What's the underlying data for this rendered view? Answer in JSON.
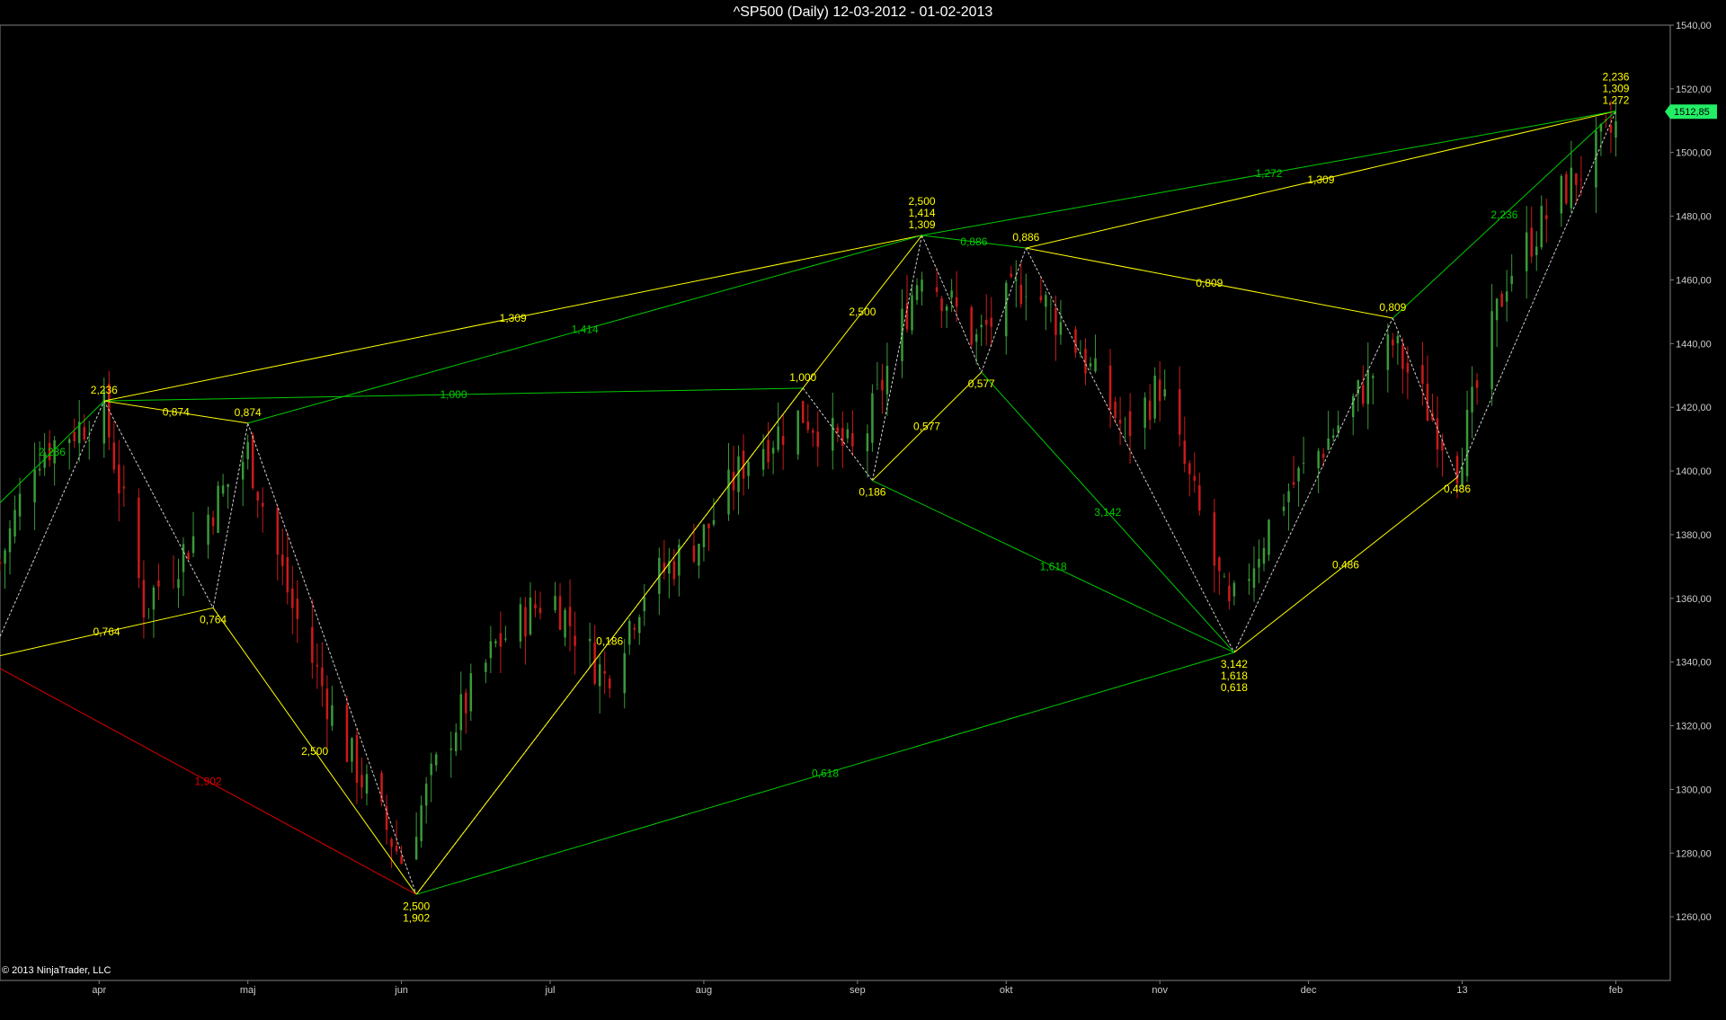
{
  "title": "^SP500 (Daily)  12-03-2012 - 01-02-2013",
  "copyright": "© 2013 NinjaTrader, LLC",
  "colors": {
    "background": "#000000",
    "axis": "#808080",
    "up_bar": "#3a9a3a",
    "down_bar": "#cc1a1a",
    "fib_yellow": "#ffff00",
    "fib_green": "#00cc00",
    "fib_red": "#dd0000",
    "zigzag": "#cfcfcf",
    "last_price_bg": "#22ee66"
  },
  "chart_data": {
    "type": "candlestick",
    "ylim": [
      1240,
      1540
    ],
    "y_ticks": [
      1260,
      1280,
      1300,
      1320,
      1340,
      1360,
      1380,
      1400,
      1420,
      1440,
      1460,
      1480,
      1500,
      1520,
      1540
    ],
    "y_tick_labels": [
      "1260,00",
      "1280,00",
      "1300,00",
      "1320,00",
      "1340,00",
      "1360,00",
      "1380,00",
      "1400,00",
      "1420,00",
      "1440,00",
      "1460,00",
      "1480,00",
      "1500,00",
      "1520,00",
      "1540,00"
    ],
    "last_price": 1512.85,
    "last_price_label": "1512,85",
    "x_range": [
      "2012-03-12",
      "2013-02-04"
    ],
    "x_ticks": [
      {
        "date": "2012-04-01",
        "label": "apr"
      },
      {
        "date": "2012-05-01",
        "label": "maj"
      },
      {
        "date": "2012-06-01",
        "label": "jun"
      },
      {
        "date": "2012-07-01",
        "label": "jul"
      },
      {
        "date": "2012-08-01",
        "label": "aug"
      },
      {
        "date": "2012-09-01",
        "label": "sep"
      },
      {
        "date": "2012-10-01",
        "label": "okt"
      },
      {
        "date": "2012-11-01",
        "label": "nov"
      },
      {
        "date": "2012-12-01",
        "label": "dec"
      },
      {
        "date": "2013-01-01",
        "label": "13"
      },
      {
        "date": "2013-02-01",
        "label": "feb"
      }
    ],
    "ohlc_anchors": [
      {
        "date": "2012-03-12",
        "close": 1371
      },
      {
        "date": "2012-03-19",
        "close": 1405
      },
      {
        "date": "2012-04-02",
        "close": 1419
      },
      {
        "date": "2012-04-10",
        "close": 1358
      },
      {
        "date": "2012-04-20",
        "close": 1379
      },
      {
        "date": "2012-05-01",
        "close": 1406
      },
      {
        "date": "2012-05-10",
        "close": 1357
      },
      {
        "date": "2012-05-20",
        "close": 1316
      },
      {
        "date": "2012-06-01",
        "close": 1278
      },
      {
        "date": "2012-06-10",
        "close": 1315
      },
      {
        "date": "2012-06-20",
        "close": 1345
      },
      {
        "date": "2012-07-01",
        "close": 1362
      },
      {
        "date": "2012-07-12",
        "close": 1335
      },
      {
        "date": "2012-07-20",
        "close": 1363
      },
      {
        "date": "2012-08-01",
        "close": 1380
      },
      {
        "date": "2012-08-10",
        "close": 1405
      },
      {
        "date": "2012-08-21",
        "close": 1418
      },
      {
        "date": "2012-09-01",
        "close": 1404
      },
      {
        "date": "2012-09-14",
        "close": 1465
      },
      {
        "date": "2012-09-25",
        "close": 1441
      },
      {
        "date": "2012-10-05",
        "close": 1460
      },
      {
        "date": "2012-10-15",
        "close": 1440
      },
      {
        "date": "2012-10-25",
        "close": 1412
      },
      {
        "date": "2012-11-01",
        "close": 1427
      },
      {
        "date": "2012-11-15",
        "close": 1355
      },
      {
        "date": "2012-11-25",
        "close": 1390
      },
      {
        "date": "2012-12-05",
        "close": 1410
      },
      {
        "date": "2012-12-18",
        "close": 1440
      },
      {
        "date": "2012-12-31",
        "close": 1402
      },
      {
        "date": "2013-01-10",
        "close": 1461
      },
      {
        "date": "2013-01-20",
        "close": 1485
      },
      {
        "date": "2013-02-01",
        "close": 1508
      }
    ],
    "pivots": [
      {
        "id": "P0",
        "date": "2012-03-12",
        "price": 1348
      },
      {
        "id": "P1",
        "date": "2012-04-02",
        "price": 1422
      },
      {
        "id": "P2",
        "date": "2012-04-24",
        "price": 1357
      },
      {
        "id": "P3",
        "date": "2012-05-01",
        "price": 1415
      },
      {
        "id": "P4",
        "date": "2012-06-04",
        "price": 1267
      },
      {
        "id": "P5",
        "date": "2012-08-21",
        "price": 1426
      },
      {
        "id": "P6",
        "date": "2012-09-04",
        "price": 1397
      },
      {
        "id": "P7",
        "date": "2012-09-14",
        "price": 1474
      },
      {
        "id": "P8",
        "date": "2012-09-26",
        "price": 1431
      },
      {
        "id": "P9",
        "date": "2012-10-05",
        "price": 1470
      },
      {
        "id": "P10",
        "date": "2012-11-16",
        "price": 1343
      },
      {
        "id": "P11",
        "date": "2012-12-18",
        "price": 1448
      },
      {
        "id": "P12",
        "date": "2012-12-31",
        "price": 1398
      },
      {
        "id": "P13",
        "date": "2013-02-01",
        "price": 1513
      }
    ],
    "fib_lines": [
      {
        "from": "P1",
        "to": "P7",
        "color": "yellow",
        "label": "1,309"
      },
      {
        "from": "P3",
        "to": "P7",
        "color": "green",
        "label": "1,414"
      },
      {
        "from": "P1",
        "to": "P5",
        "color": "green",
        "label": "1,000"
      },
      {
        "from": "P1",
        "to": "P3",
        "color": "yellow",
        "label": "0,874"
      },
      {
        "from": "P2",
        "to": "P4",
        "color": "yellow",
        "label": "2,500"
      },
      {
        "from": "P4",
        "to": "P5",
        "color": "yellow",
        "label": "0,186"
      },
      {
        "from": "P4",
        "to": "P10",
        "color": "green",
        "label": "0,618"
      },
      {
        "from": "P5",
        "to": "P7",
        "color": "yellow",
        "label": "2,500"
      },
      {
        "from": "P6",
        "to": "P8",
        "color": "yellow",
        "label": "0,577"
      },
      {
        "from": "P6",
        "to": "P10",
        "color": "green",
        "label": "1,618"
      },
      {
        "from": "P7",
        "to": "P9",
        "color": "green",
        "label": "0,886"
      },
      {
        "from": "P8",
        "to": "P10",
        "color": "green",
        "label": "3,142"
      },
      {
        "from": "P9",
        "to": "P11",
        "color": "yellow",
        "label": "0,809"
      },
      {
        "from": "P9",
        "to": "P13",
        "color": "yellow",
        "label": "1,309"
      },
      {
        "from": "P7",
        "to": "P13",
        "color": "green",
        "label": "1,272"
      },
      {
        "from": "P10",
        "to": "P12",
        "color": "yellow",
        "label": "0,486"
      },
      {
        "from": "P11",
        "to": "P13",
        "color": "green",
        "label": "2,236"
      }
    ],
    "edge_lines": [
      {
        "x0": "2012-03-12",
        "y0": 1342,
        "x1": "P2",
        "color": "yellow",
        "label": "0,764"
      },
      {
        "x0": "2012-03-12",
        "y0": 1338,
        "x1": "P4",
        "color": "red",
        "label": "1,902"
      },
      {
        "x0": "2012-03-12",
        "y0": 1390,
        "x1": "P1",
        "color": "green",
        "label": "2,236"
      }
    ],
    "pivot_labels": [
      {
        "pivot": "P1",
        "text": [
          "2,236"
        ],
        "pos": "above"
      },
      {
        "pivot": "P2",
        "text": [
          "0,764"
        ],
        "pos": "below"
      },
      {
        "pivot": "P3",
        "text": [
          "0,874"
        ],
        "pos": "above"
      },
      {
        "pivot": "P4",
        "text": [
          "2,500",
          "1,902"
        ],
        "pos": "below"
      },
      {
        "pivot": "P5",
        "text": [
          "1,000"
        ],
        "pos": "above"
      },
      {
        "pivot": "P6",
        "text": [
          "0,186"
        ],
        "pos": "below"
      },
      {
        "pivot": "P7",
        "text": [
          "2,500",
          "1,414",
          "1,309"
        ],
        "pos": "above"
      },
      {
        "pivot": "P8",
        "text": [
          "0,577"
        ],
        "pos": "below"
      },
      {
        "pivot": "P9",
        "text": [
          "0,886"
        ],
        "pos": "above"
      },
      {
        "pivot": "P10",
        "text": [
          "3,142",
          "1,618",
          "0,618"
        ],
        "pos": "below"
      },
      {
        "pivot": "P11",
        "text": [
          "0,809"
        ],
        "pos": "above"
      },
      {
        "pivot": "P12",
        "text": [
          "0,486"
        ],
        "pos": "below"
      },
      {
        "pivot": "P13",
        "text": [
          "2,236",
          "1,309",
          "1,272"
        ],
        "pos": "above"
      }
    ]
  }
}
